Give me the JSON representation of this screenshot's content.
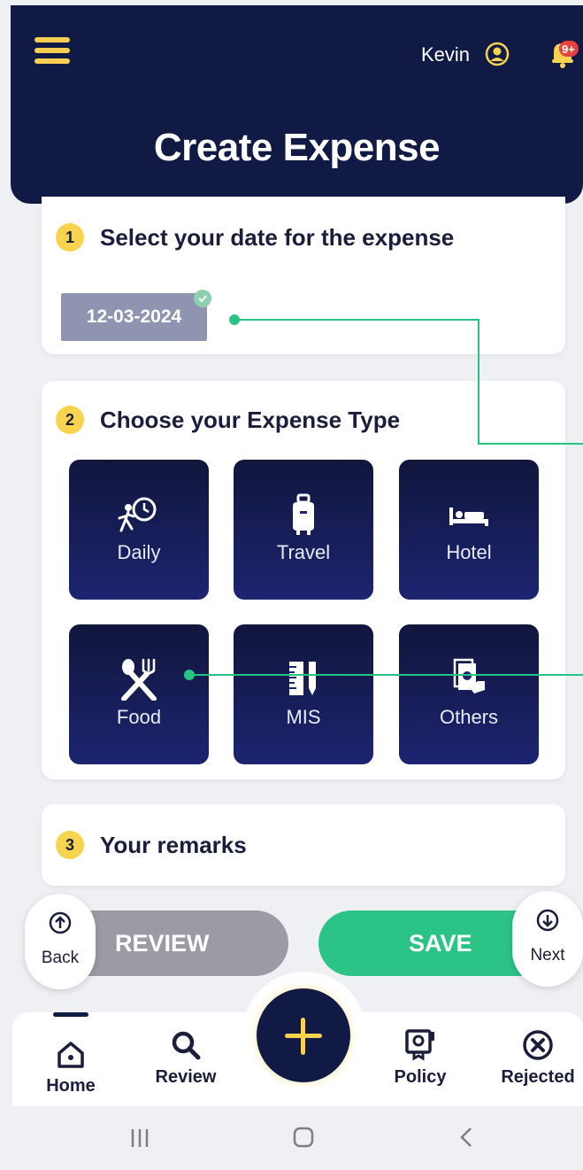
{
  "header": {
    "user_name": "Kevin",
    "notification_badge": "9+",
    "title": "Create Expense"
  },
  "step1": {
    "number": "1",
    "label": "Select your date for the expense",
    "date_value": "12-03-2024"
  },
  "step2": {
    "number": "2",
    "label": "Choose your Expense Type",
    "types": [
      {
        "label": "Daily",
        "icon": "daily-clock-icon"
      },
      {
        "label": "Travel",
        "icon": "luggage-icon"
      },
      {
        "label": "Hotel",
        "icon": "bed-icon"
      },
      {
        "label": "Food",
        "icon": "fork-spoon-icon"
      },
      {
        "label": "MIS",
        "icon": "ruler-pencil-icon"
      },
      {
        "label": "Others",
        "icon": "money-hand-icon"
      }
    ]
  },
  "step3": {
    "number": "3",
    "label": "Your remarks"
  },
  "actions": {
    "review_label": "REVIEW",
    "save_label": "SAVE",
    "back_label": "Back",
    "next_label": "Next"
  },
  "bottom_nav": {
    "items": [
      {
        "label": "Home",
        "icon": "home-icon"
      },
      {
        "label": "Review",
        "icon": "search-icon"
      },
      {
        "label": "Policy",
        "icon": "policy-icon"
      },
      {
        "label": "Rejected",
        "icon": "close-circle-icon"
      }
    ]
  },
  "colors": {
    "header_bg": "#111a44",
    "accent_yellow": "#f7d34f",
    "save_green": "#2cc387",
    "review_gray": "#9a9ba5",
    "tile_bg": "#1d2470"
  }
}
